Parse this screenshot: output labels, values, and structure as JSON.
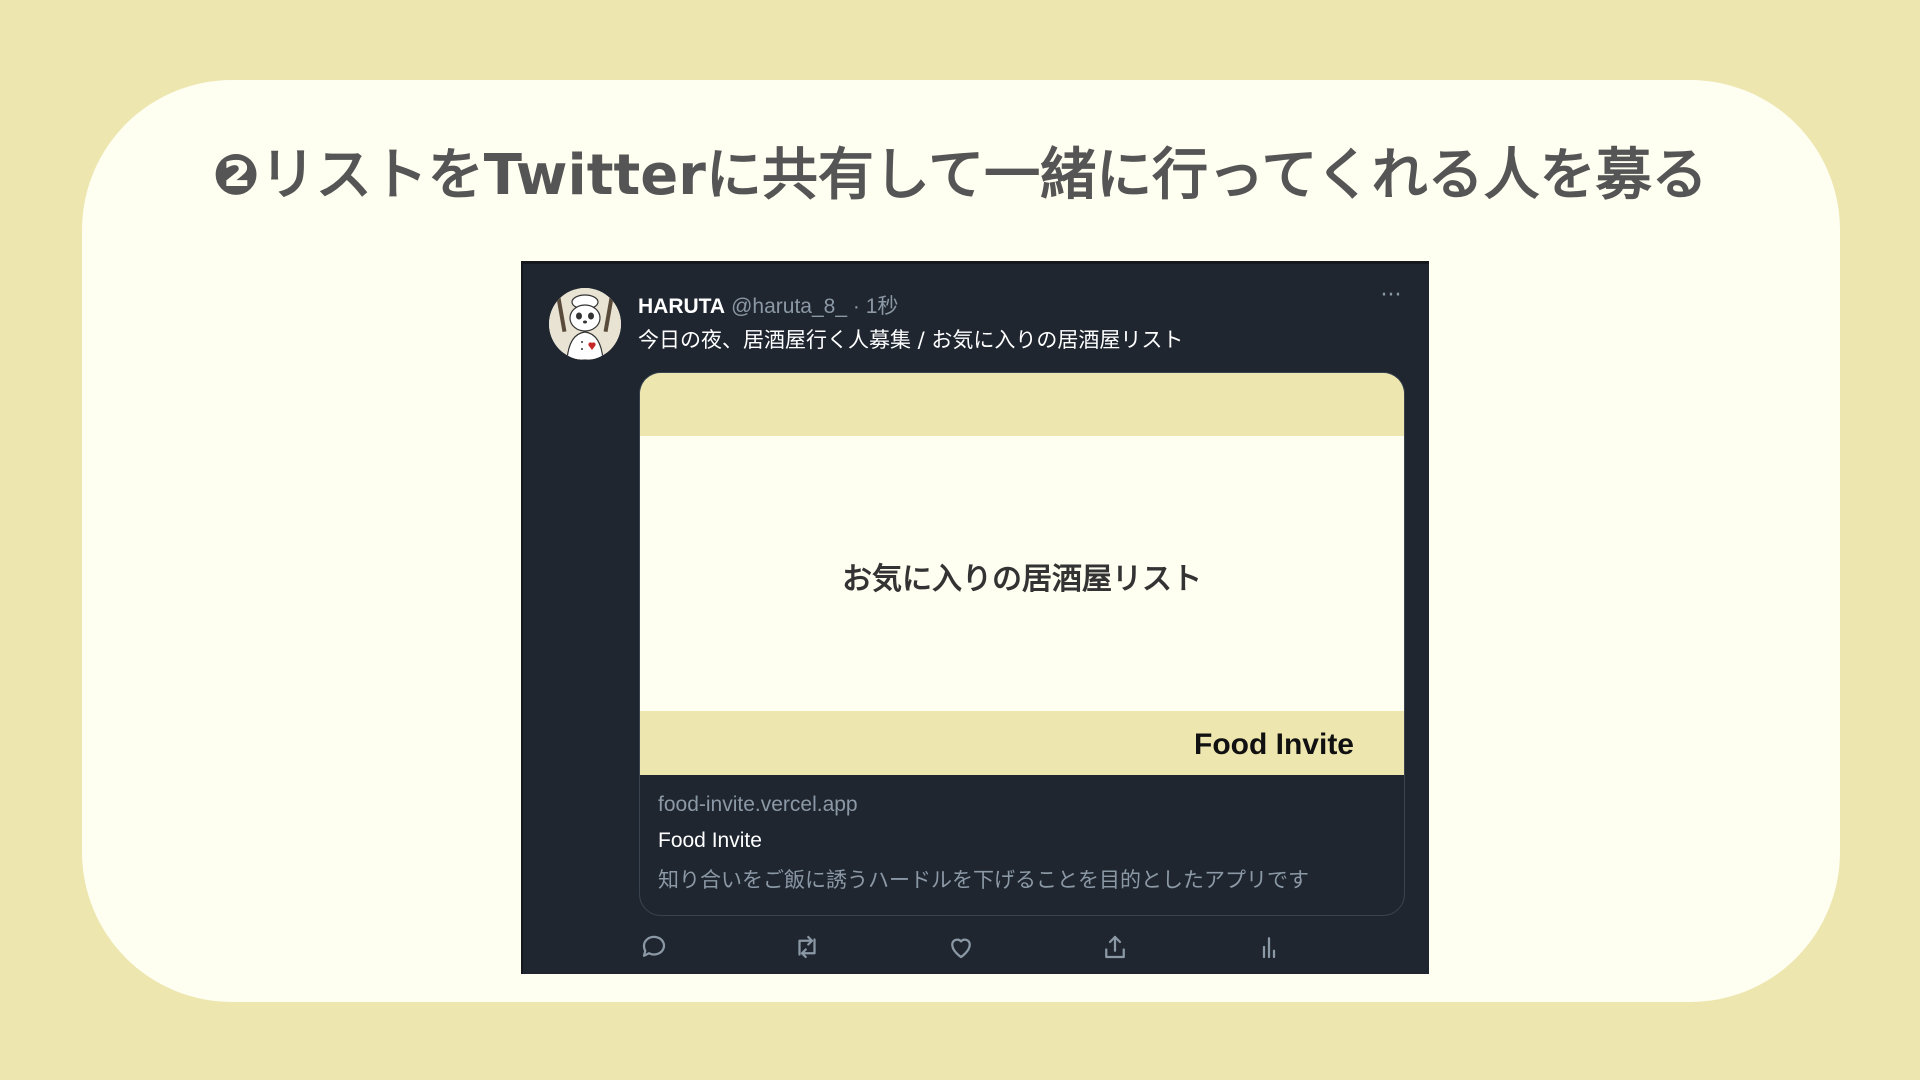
{
  "slide": {
    "heading": "❷リストをTwitterに共有して一緒に行ってくれる人を募る"
  },
  "tweet": {
    "author_name": "HARUTA",
    "handle": "@haruta_8_",
    "separator": " · ",
    "time": "1秒",
    "text": "今日の夜、居酒屋行く人募集 / お気に入りの居酒屋リスト",
    "more_label": "···",
    "link_card": {
      "image_title": "お気に入りの居酒屋リスト",
      "image_brand": "Food Invite",
      "domain": "food-invite.vercel.app",
      "title": "Food Invite",
      "description": "知り合いをご飯に誘うハードルを下げることを目的としたアプリです"
    },
    "actions": [
      {
        "icon": "reply-icon"
      },
      {
        "icon": "retweet-icon"
      },
      {
        "icon": "like-icon"
      },
      {
        "icon": "share-icon"
      },
      {
        "icon": "analytics-icon"
      }
    ]
  },
  "colors": {
    "page_background": "#ede6af",
    "card_background": "#fefef1",
    "tweet_background": "#1f2630",
    "accent_band": "#ede6af",
    "muted_text": "#8b98a5"
  }
}
